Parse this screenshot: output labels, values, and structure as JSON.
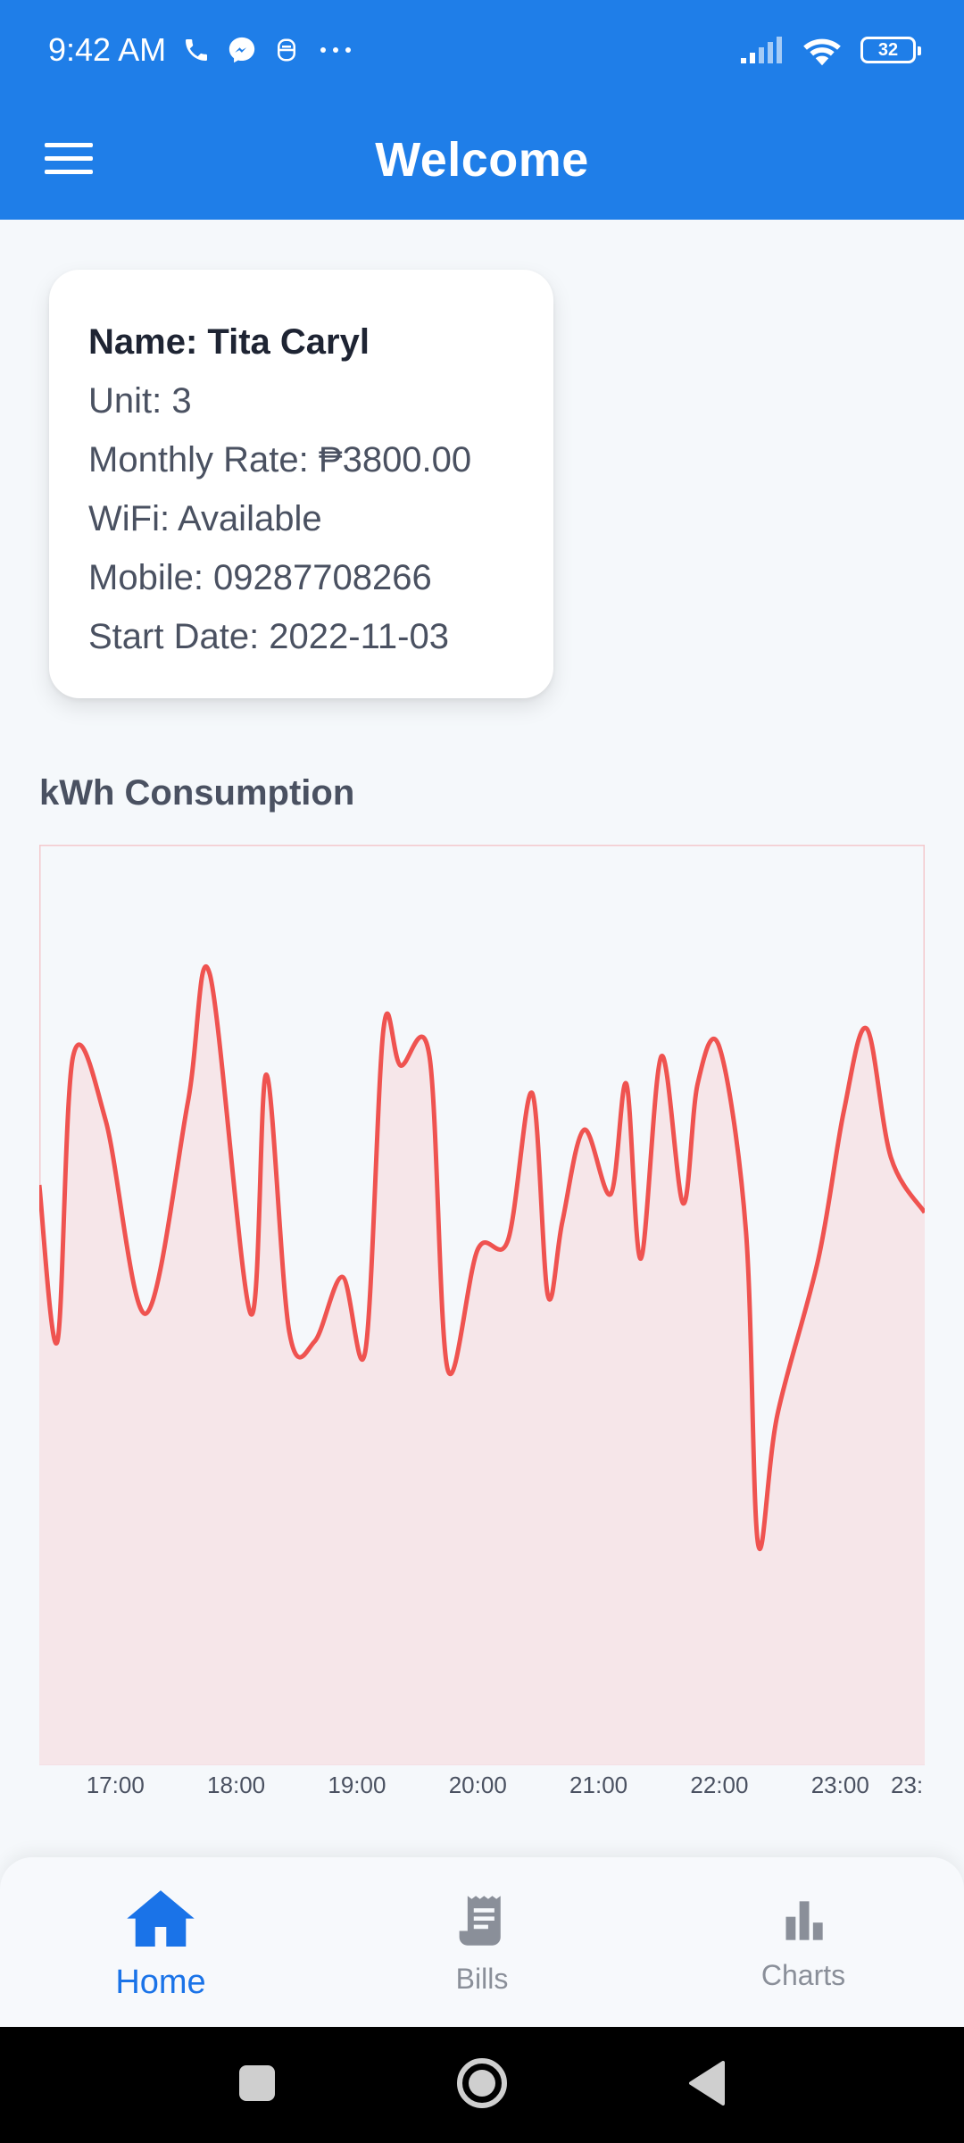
{
  "status_bar": {
    "time": "9:42 AM",
    "battery": "32",
    "icons": [
      "phone-icon",
      "messenger-icon",
      "sim-icon",
      "more-dots-icon",
      "signal-icon",
      "wifi-icon",
      "battery-icon"
    ]
  },
  "app_bar": {
    "title": "Welcome",
    "menu_icon": "hamburger-menu-icon"
  },
  "tenant": {
    "name": "Name: Tita Caryl",
    "unit": "Unit: 3",
    "monthly_rate": "Monthly Rate: ₱3800.00",
    "wifi": "WiFi: Available",
    "mobile": "Mobile: 09287708266",
    "start_date": "Start Date: 2022-11-03"
  },
  "chart_section": {
    "title": "kWh Consumption"
  },
  "chart_data": {
    "type": "area",
    "title": "kWh Consumption",
    "xlabel": "",
    "ylabel": "",
    "x_tick_labels": [
      "17:00",
      "18:00",
      "19:00",
      "20:00",
      "21:00",
      "22:00",
      "23:00",
      "23:"
    ],
    "x_hours": [
      16.37,
      16.52,
      16.65,
      16.92,
      17.25,
      17.6,
      17.78,
      18.12,
      18.25,
      18.44,
      18.65,
      18.88,
      19.07,
      19.22,
      19.36,
      19.6,
      19.75,
      20.0,
      20.25,
      20.45,
      20.58,
      20.7,
      20.88,
      21.1,
      21.23,
      21.35,
      21.52,
      21.7,
      21.82,
      22.0,
      22.22,
      22.32,
      22.48,
      22.82,
      23.03,
      23.22,
      23.42,
      23.7
    ],
    "values": [
      0.63,
      0.46,
      0.77,
      0.7,
      0.49,
      0.72,
      0.86,
      0.49,
      0.75,
      0.47,
      0.46,
      0.53,
      0.45,
      0.8,
      0.76,
      0.77,
      0.43,
      0.56,
      0.57,
      0.73,
      0.51,
      0.59,
      0.69,
      0.62,
      0.74,
      0.55,
      0.77,
      0.61,
      0.74,
      0.78,
      0.58,
      0.24,
      0.38,
      0.55,
      0.71,
      0.8,
      0.66,
      0.6
    ],
    "line_color": "#ef5350",
    "fill_color": "#f6e6e9",
    "grid": false,
    "legend": "none"
  },
  "bottom_nav": {
    "items": [
      {
        "label": "Home",
        "icon": "home-icon",
        "active": true
      },
      {
        "label": "Bills",
        "icon": "receipt-icon",
        "active": false
      },
      {
        "label": "Charts",
        "icon": "bar-chart-icon",
        "active": false
      }
    ]
  },
  "colors": {
    "primary": "#1f7ee8",
    "active_nav": "#1a73e8",
    "inactive_nav": "#8a8f99"
  }
}
